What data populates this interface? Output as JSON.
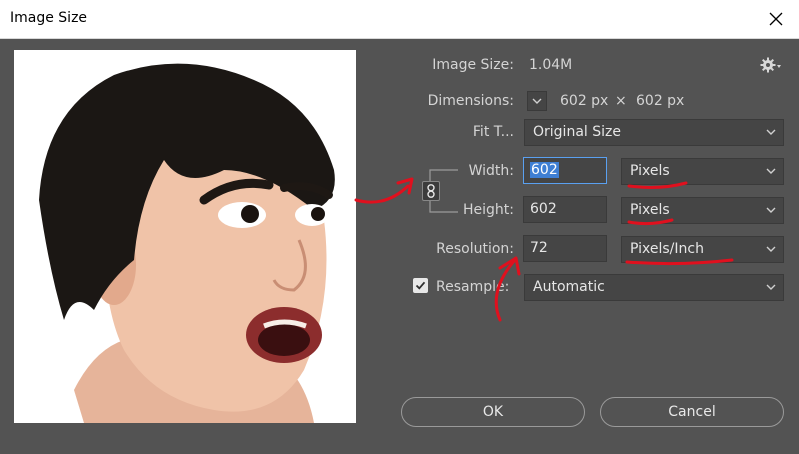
{
  "window": {
    "title": "Image Size"
  },
  "info": {
    "image_size_label": "Image Size:",
    "image_size_value": "1.04M",
    "dimensions_label": "Dimensions:",
    "dim_width": "602 px",
    "dim_times": "×",
    "dim_height": "602 px"
  },
  "fit": {
    "label": "Fit T...",
    "value": "Original Size"
  },
  "width": {
    "label": "Width:",
    "value": "602",
    "unit": "Pixels"
  },
  "height": {
    "label": "Height:",
    "value": "602",
    "unit": "Pixels"
  },
  "resolution": {
    "label": "Resolution:",
    "value": "72",
    "unit": "Pixels/Inch"
  },
  "resample": {
    "label": "Resample:",
    "value": "Automatic",
    "checked": true
  },
  "buttons": {
    "ok": "OK",
    "cancel": "Cancel"
  },
  "icons": {
    "close": "close-icon",
    "settings": "gear-icon",
    "link": "chain-link-icon",
    "dim_toggle": "chevron-down-icon",
    "checkbox": "checkmark-icon"
  },
  "colors": {
    "dialog_bg": "#535353",
    "field_bg": "#454545",
    "selection": "#3f7fd4",
    "annotation": "#e0101e"
  }
}
